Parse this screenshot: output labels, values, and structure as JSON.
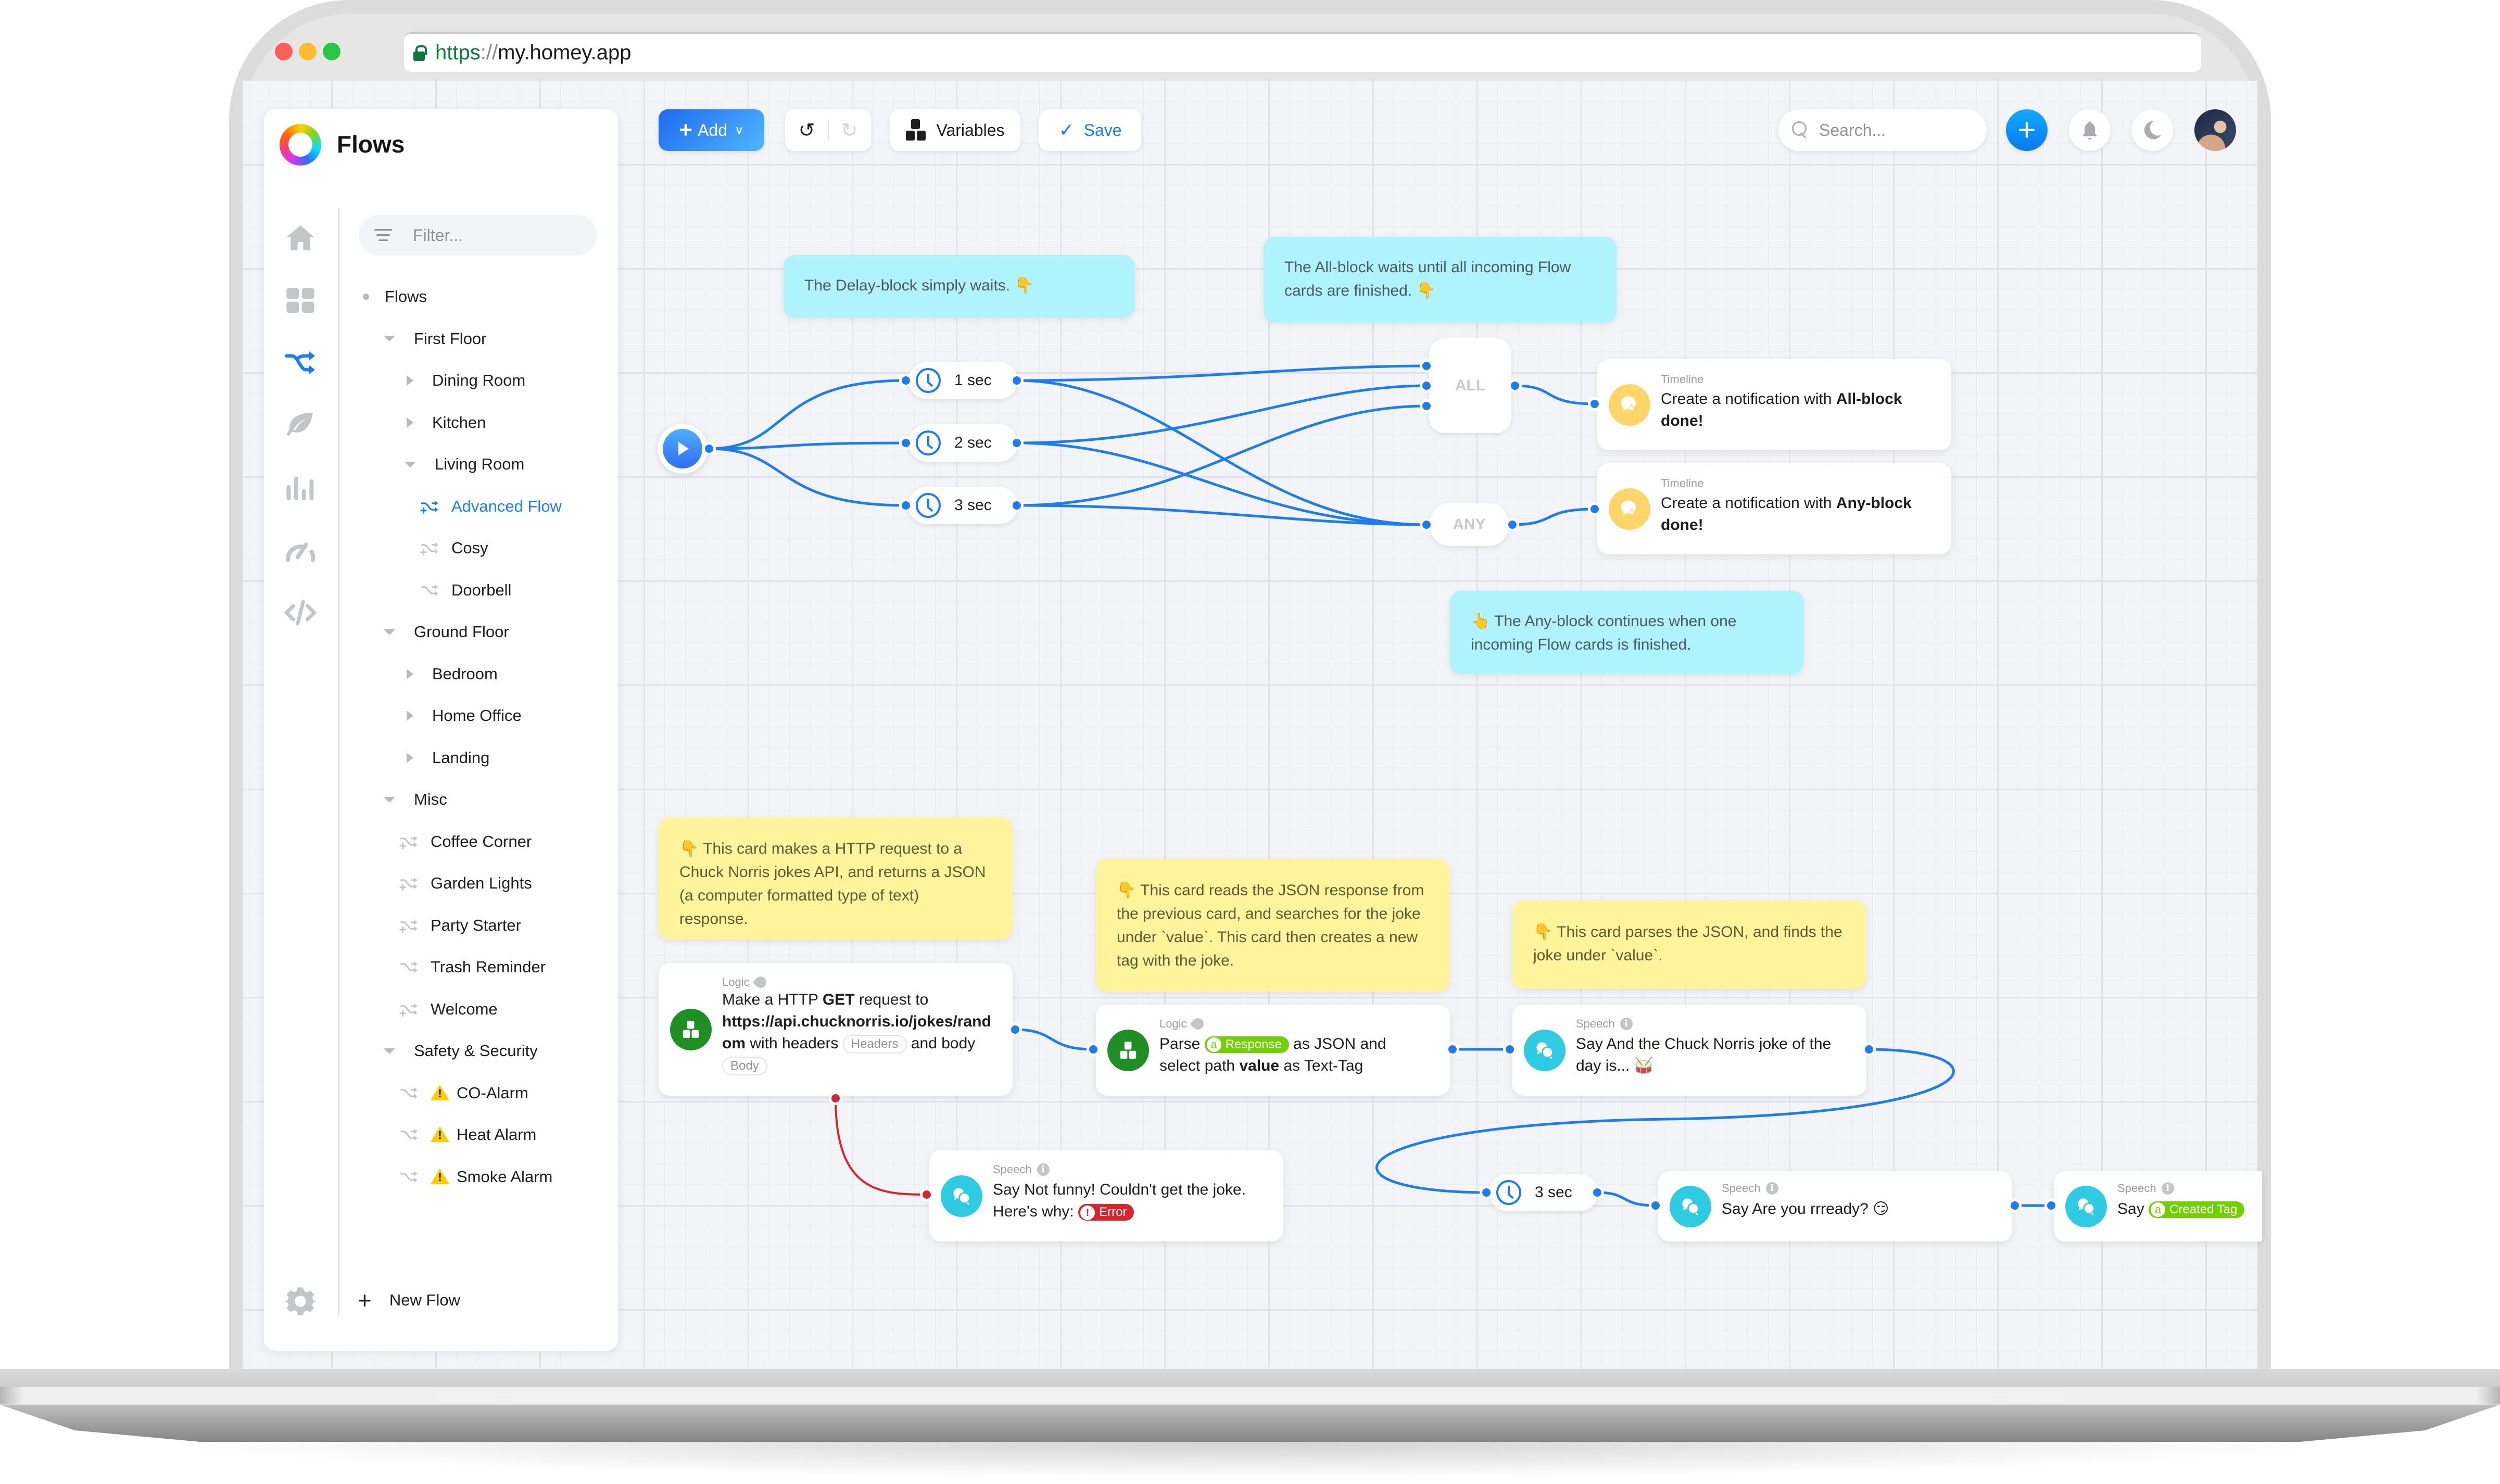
{
  "browser": {
    "url_scheme": "https",
    "url_separator": "://",
    "url_host": "my.homey.app"
  },
  "sidebar": {
    "title": "Flows",
    "filter_placeholder": "Filter...",
    "nav_icons": [
      "home-icon",
      "dashboard-icon",
      "flows-icon",
      "energy-icon",
      "insights-icon",
      "performance-icon",
      "developer-icon"
    ],
    "tree": [
      {
        "label": "Flows",
        "type": "root"
      },
      {
        "label": "First Floor",
        "type": "folder-open"
      },
      {
        "label": "Dining Room",
        "type": "folder-closed"
      },
      {
        "label": "Kitchen",
        "type": "folder-closed"
      },
      {
        "label": "Living Room",
        "type": "folder-open"
      },
      {
        "label": "Advanced Flow",
        "type": "advanced-flow",
        "active": true
      },
      {
        "label": "Cosy",
        "type": "advanced-flow"
      },
      {
        "label": "Doorbell",
        "type": "flow"
      },
      {
        "label": "Ground Floor",
        "type": "folder-open"
      },
      {
        "label": "Bedroom",
        "type": "folder-closed"
      },
      {
        "label": "Home Office",
        "type": "folder-closed"
      },
      {
        "label": "Landing",
        "type": "folder-closed"
      },
      {
        "label": "Misc",
        "type": "folder-open"
      },
      {
        "label": "Coffee Corner",
        "type": "advanced-flow"
      },
      {
        "label": "Garden Lights",
        "type": "advanced-flow"
      },
      {
        "label": "Party Starter",
        "type": "advanced-flow"
      },
      {
        "label": "Trash Reminder",
        "type": "flow"
      },
      {
        "label": "Welcome",
        "type": "advanced-flow"
      },
      {
        "label": "Safety & Security",
        "type": "folder-open"
      },
      {
        "label": "CO-Alarm",
        "type": "flow",
        "warning": true
      },
      {
        "label": "Heat Alarm",
        "type": "flow",
        "warning": true
      },
      {
        "label": "Smoke Alarm",
        "type": "flow",
        "warning": true
      }
    ],
    "new_flow_label": "New Flow"
  },
  "toolbar": {
    "add_label": "Add",
    "variables_label": "Variables",
    "save_label": "Save",
    "search_placeholder": "Search..."
  },
  "colors": {
    "accent": "#1b7cf3",
    "note_cyan": "#aef3fd",
    "note_yellow": "#fff39c",
    "logic_green": "#1f8f24",
    "speech_cyan": "#2ecbe3",
    "timeline_yellow": "#ffd56a",
    "tag_green": "#6fd100",
    "error_red": "#d8242a"
  },
  "canvas": {
    "notes": {
      "delay": "The Delay-block simply waits. 👇",
      "all": "The All-block waits until all incoming Flow cards are finished. 👇",
      "any": "👆 The Any-block continues when one incoming Flow cards is finished.",
      "http": "👇 This card makes a HTTP request to a Chuck Norris jokes API, and returns a JSON (a computer formatted type of text) response.",
      "parse": "👇 This card reads the JSON response from the previous card, and searches for the joke under `value`. This card then creates a new tag with the joke.",
      "speech": "👇 This card parses the JSON, and finds the joke under `value`."
    },
    "delays": [
      "1 sec",
      "2 sec",
      "3 sec"
    ],
    "delay_bottom": "3 sec",
    "all_label": "ALL",
    "any_label": "ANY",
    "timeline_all": {
      "category": "Timeline",
      "prefix": "Create a notification with ",
      "bold": "All-block",
      "suffix": "done!"
    },
    "timeline_any": {
      "category": "Timeline",
      "prefix": "Create a notification with ",
      "bold": "Any-block",
      "suffix": "done!"
    },
    "http_card": {
      "category": "Logic",
      "t1": "Make a HTTP ",
      "method": "GET",
      "t2": " request to",
      "url_a": "https://api.chucknorris.io/jokes/rand",
      "url_b": "om",
      "t3": " with headers ",
      "headers_pill": "Headers",
      "t4": " and body",
      "body_pill": "Body"
    },
    "parse_card": {
      "category": "Logic",
      "t1": "Parse ",
      "tag_pill": "Response",
      "t2": " as JSON and",
      "t3": "select path ",
      "path": "value",
      "t4": " as Text-Tag"
    },
    "speech_joke": {
      "category": "Speech",
      "verb": "Say ",
      "text_a": "And the Chuck Norris joke of the",
      "text_b": "day is... 🥁"
    },
    "speech_error": {
      "category": "Speech",
      "verb": "Say ",
      "text_a": "Not funny! Couldn't get the joke.",
      "text_b": "Here's why: ",
      "error_pill": "Error"
    },
    "speech_ready": {
      "category": "Speech",
      "verb": "Say ",
      "text": "Are you rrready? 😏"
    },
    "speech_tag": {
      "category": "Speech",
      "verb": "Say ",
      "tag_pill": "Created Tag"
    },
    "tag_letter": "a"
  }
}
